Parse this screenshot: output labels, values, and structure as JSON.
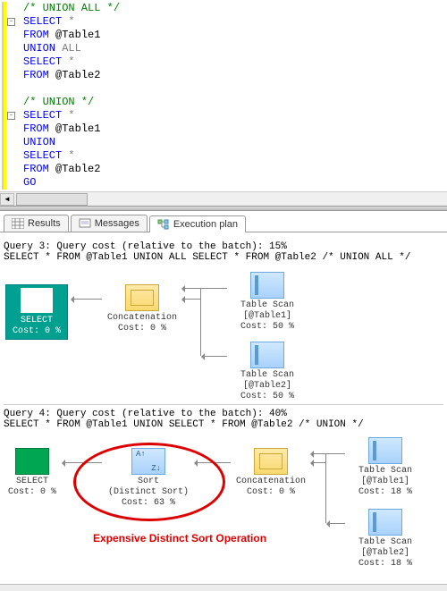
{
  "editor_lines": [
    {
      "fold": "",
      "tokens": [
        {
          "c": "green",
          "t": "/* UNION ALL */"
        }
      ]
    },
    {
      "fold": "-",
      "tokens": [
        {
          "c": "kw",
          "t": "SELECT"
        },
        {
          "c": "blk",
          "t": " "
        },
        {
          "c": "gray",
          "t": "*"
        }
      ]
    },
    {
      "fold": "",
      "tokens": [
        {
          "c": "kw",
          "t": "FROM"
        },
        {
          "c": "blk",
          "t": " @Table1"
        }
      ]
    },
    {
      "fold": "",
      "tokens": [
        {
          "c": "kw",
          "t": "UNION"
        },
        {
          "c": "blk",
          "t": " "
        },
        {
          "c": "gray",
          "t": "ALL"
        }
      ]
    },
    {
      "fold": "",
      "tokens": [
        {
          "c": "kw",
          "t": "SELECT"
        },
        {
          "c": "blk",
          "t": " "
        },
        {
          "c": "gray",
          "t": "*"
        }
      ]
    },
    {
      "fold": "",
      "tokens": [
        {
          "c": "kw",
          "t": "FROM"
        },
        {
          "c": "blk",
          "t": " @Table2"
        }
      ]
    },
    {
      "fold": "",
      "tokens": []
    },
    {
      "fold": "",
      "tokens": [
        {
          "c": "green",
          "t": "/* UNION */"
        }
      ]
    },
    {
      "fold": "-",
      "tokens": [
        {
          "c": "kw",
          "t": "SELECT"
        },
        {
          "c": "blk",
          "t": " "
        },
        {
          "c": "gray",
          "t": "*"
        }
      ]
    },
    {
      "fold": "",
      "tokens": [
        {
          "c": "kw",
          "t": "FROM"
        },
        {
          "c": "blk",
          "t": " @Table1"
        }
      ]
    },
    {
      "fold": "",
      "tokens": [
        {
          "c": "kw",
          "t": "UNION"
        }
      ]
    },
    {
      "fold": "",
      "tokens": [
        {
          "c": "kw",
          "t": "SELECT"
        },
        {
          "c": "blk",
          "t": " "
        },
        {
          "c": "gray",
          "t": "*"
        }
      ]
    },
    {
      "fold": "",
      "tokens": [
        {
          "c": "kw",
          "t": "FROM"
        },
        {
          "c": "blk",
          "t": " @Table2"
        }
      ]
    },
    {
      "fold": "",
      "tokens": [
        {
          "c": "kw",
          "t": "GO"
        }
      ]
    }
  ],
  "tabs": {
    "results": "Results",
    "messages": "Messages",
    "plan": "Execution plan"
  },
  "query3": {
    "header1": "Query 3: Query cost (relative to the batch): 15%",
    "header2": "SELECT * FROM @Table1 UNION ALL SELECT * FROM @Table2 /* UNION ALL */",
    "select": {
      "label": "SELECT",
      "cost": "Cost: 0 %"
    },
    "concat": {
      "label": "Concatenation",
      "cost": "Cost: 0 %"
    },
    "scan1": {
      "label": "Table Scan",
      "sub": "[@Table1]",
      "cost": "Cost: 50 %"
    },
    "scan2": {
      "label": "Table Scan",
      "sub": "[@Table2]",
      "cost": "Cost: 50 %"
    }
  },
  "query4": {
    "header1": "Query 4: Query cost (relative to the batch): 40%",
    "header2": "SELECT * FROM @Table1 UNION SELECT * FROM @Table2 /* UNION */",
    "select": {
      "label": "SELECT",
      "cost": "Cost: 0 %"
    },
    "sort": {
      "label": "Sort",
      "sub": "(Distinct Sort)",
      "cost": "Cost: 63 %"
    },
    "concat": {
      "label": "Concatenation",
      "cost": "Cost: 0 %"
    },
    "scan1": {
      "label": "Table Scan",
      "sub": "[@Table1]",
      "cost": "Cost: 18 %"
    },
    "scan2": {
      "label": "Table Scan",
      "sub": "[@Table2]",
      "cost": "Cost: 18 %"
    },
    "annotation": "Expensive Distinct Sort Operation"
  }
}
